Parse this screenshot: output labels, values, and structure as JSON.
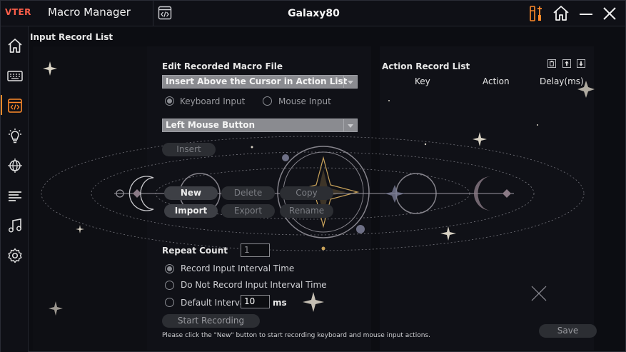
{
  "titlebar": {
    "brand": "VTER",
    "app_name": "Macro Manager",
    "device_name": "Galaxy80"
  },
  "sidebar": {
    "items": [
      {
        "icon": "home-icon"
      },
      {
        "icon": "keyboard-icon"
      },
      {
        "icon": "macro-icon",
        "active": true
      },
      {
        "icon": "lighting-icon"
      },
      {
        "icon": "network-icon"
      },
      {
        "icon": "list-icon"
      },
      {
        "icon": "music-icon"
      },
      {
        "icon": "settings-icon"
      }
    ]
  },
  "main": {
    "section_title": "Input Record List",
    "edit": {
      "title": "Edit Recorded Macro File",
      "insert_position": "Insert Above the Cursor in Action List",
      "keyboard_input": "Keyboard Input",
      "mouse_input": "Mouse Input",
      "mouse_button": "Left Mouse Button",
      "insert_label": "Insert"
    },
    "buttons": {
      "new": "New",
      "delete": "Delete",
      "copy": "Copy",
      "import": "Import",
      "export": "Export",
      "rename": "Rename"
    },
    "repeat": {
      "label": "Repeat Count",
      "value": "1",
      "record_interval": "Record Input Interval Time",
      "no_record_interval": "Do Not Record Input Interval Time",
      "default_interval": "Default Interval",
      "default_interval_value": "10",
      "unit": "ms",
      "start_recording": "Start Recording"
    },
    "hint": "Please click the \"New\" button to start recording keyboard and mouse input actions.",
    "action_list": {
      "title": "Action Record List",
      "columns": [
        "Key",
        "Action",
        "Delay(ms)"
      ],
      "save": "Save"
    }
  },
  "colors": {
    "accent": "#ff8a2a",
    "brand": "#ff5f4a",
    "decor_gold": "#c8a25a"
  }
}
